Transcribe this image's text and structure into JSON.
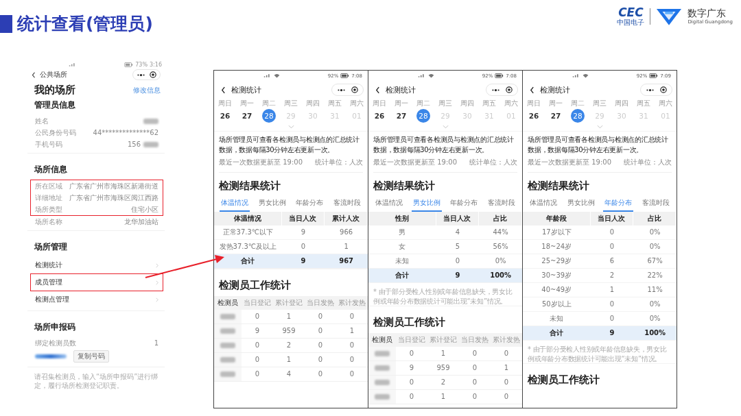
{
  "slide": {
    "title": "统计查看(管理员)"
  },
  "logos": {
    "cec": "CEC",
    "cec_cn": "中国电子",
    "brand_cn": "数字广东",
    "brand_en": "Digital Guangdong"
  },
  "venue_phone": {
    "battery": "73%",
    "time": "3:16",
    "nav_title": "公共场所",
    "page_title": "我的场所",
    "edit_link": "修改信息",
    "sections": [
      {
        "title": "管理员信息",
        "rows": [
          {
            "kind": "field",
            "label": "姓名",
            "redacted": true,
            "highlighted": false
          },
          {
            "kind": "field",
            "label": "公民身份号码",
            "value": "44**************62",
            "redacted": false,
            "highlighted": false
          },
          {
            "kind": "field",
            "label": "手机号码",
            "value": "156",
            "redacted": true,
            "highlighted": false
          }
        ]
      },
      {
        "title": "场所信息",
        "rows": [
          {
            "kind": "field",
            "label": "所在区域",
            "value": "广东省广州市海珠区新港街道",
            "redacted": false,
            "highlighted": true
          },
          {
            "kind": "field",
            "label": "详细地址",
            "value": "广东省广州市海珠区阅江西路",
            "redacted": false,
            "highlighted": true
          },
          {
            "kind": "field",
            "label": "场所类型",
            "value": "住宅小区",
            "redacted": false,
            "highlighted": true
          },
          {
            "kind": "field",
            "label": "场所名称",
            "value": "龙华加油站",
            "redacted": false,
            "highlighted": false
          }
        ]
      },
      {
        "title": "场所管理",
        "rows": [
          {
            "kind": "link",
            "label": "检测统计",
            "highlighted": false
          },
          {
            "kind": "link",
            "label": "成员管理",
            "highlighted": true
          },
          {
            "kind": "link",
            "label": "检测点管理",
            "highlighted": false
          }
        ]
      },
      {
        "title": "场所申报码",
        "rows": [
          {
            "kind": "field",
            "label": "绑定检测员数",
            "value": "1",
            "redacted": false,
            "highlighted": false
          },
          {
            "kind": "code",
            "button": "复制号码",
            "highlighted": false
          }
        ]
      }
    ],
    "hint": "请召集检测员，输入“场所申报码”进行绑定，履行场所检测登记职责。"
  },
  "link_arrow": true,
  "phones": [
    {
      "battery": "92%",
      "time": "7:08",
      "nav_title": "检测统计",
      "weekdays": [
        "周日",
        "周一",
        "周二",
        "周三",
        "周四",
        "周五",
        "周六"
      ],
      "dates": [
        {
          "label": "26",
          "selected": false,
          "future": false
        },
        {
          "label": "27",
          "selected": false,
          "future": false
        },
        {
          "label": "28",
          "selected": true,
          "future": false
        },
        {
          "label": "29",
          "selected": false,
          "future": true
        },
        {
          "label": "30",
          "selected": false,
          "future": true
        },
        {
          "label": "31",
          "selected": false,
          "future": true
        },
        {
          "label": "01",
          "selected": false,
          "future": true
        }
      ],
      "description": "场所管理员可查看各检测员与检测点的汇总统计数据，数据每隔30分钟左右更新一次。",
      "update_note": "最近一次数据更新至 19:00",
      "unit": "统计单位：人次",
      "result_heading": "检测结果统计",
      "tabs": [
        {
          "label": "体温情况",
          "selected": true
        },
        {
          "label": "男女比例",
          "selected": false
        },
        {
          "label": "年龄分布",
          "selected": false
        },
        {
          "label": "客流时段",
          "selected": false
        }
      ],
      "result_table": {
        "columns": [
          "体温情况",
          "当日人次",
          "累计人次"
        ],
        "rows": [
          {
            "cells": [
              "正常37.3℃以下",
              "9",
              "966"
            ],
            "total": false
          },
          {
            "cells": [
              "发热37.3℃及以上",
              "0",
              "1"
            ],
            "total": false
          },
          {
            "cells": [
              "合计",
              "9",
              "967"
            ],
            "total": true
          }
        ]
      },
      "work_heading": "检测员工作统计",
      "work_table": {
        "name_column": "检测员",
        "columns": [
          "当日登记",
          "累计登记",
          "当日发热",
          "累计发热"
        ],
        "rows": [
          {
            "cells": [
              "0",
              "1",
              "0",
              "0"
            ]
          },
          {
            "cells": [
              "9",
              "959",
              "0",
              "1"
            ]
          },
          {
            "cells": [
              "0",
              "2",
              "0",
              "0"
            ]
          },
          {
            "cells": [
              "0",
              "1",
              "0",
              "0"
            ]
          },
          {
            "cells": [
              "0",
              "4",
              "0",
              "0"
            ]
          }
        ]
      }
    },
    {
      "battery": "92%",
      "time": "7:08",
      "nav_title": "检测统计",
      "weekdays": [
        "周日",
        "周一",
        "周二",
        "周三",
        "周四",
        "周五",
        "周六"
      ],
      "dates": [
        {
          "label": "26",
          "selected": false,
          "future": false
        },
        {
          "label": "27",
          "selected": false,
          "future": false
        },
        {
          "label": "28",
          "selected": true,
          "future": false
        },
        {
          "label": "29",
          "selected": false,
          "future": true
        },
        {
          "label": "30",
          "selected": false,
          "future": true
        },
        {
          "label": "31",
          "selected": false,
          "future": true
        },
        {
          "label": "01",
          "selected": false,
          "future": true
        }
      ],
      "description": "场所管理员可查看各检测员与检测点的汇总统计数据，数据每隔30分钟左右更新一次。",
      "update_note": "最近一次数据更新至 19:00",
      "unit": "统计单位：人次",
      "result_heading": "检测结果统计",
      "tabs": [
        {
          "label": "体温情况",
          "selected": false
        },
        {
          "label": "男女比例",
          "selected": true
        },
        {
          "label": "年龄分布",
          "selected": false
        },
        {
          "label": "客流时段",
          "selected": false
        }
      ],
      "result_table": {
        "columns": [
          "性别",
          "当日人次",
          "占比"
        ],
        "rows": [
          {
            "cells": [
              "男",
              "4",
              "44%"
            ],
            "total": false
          },
          {
            "cells": [
              "女",
              "5",
              "56%"
            ],
            "total": false
          },
          {
            "cells": [
              "未知",
              "0",
              "0%"
            ],
            "total": false
          },
          {
            "cells": [
              "合计",
              "9",
              "100%"
            ],
            "total": true
          }
        ]
      },
      "note": "* 由于部分受检人性别或年龄信息缺失，男女比例或年龄分布数据统计可能出现“未知”情况。",
      "work_heading": "检测员工作统计",
      "work_table": {
        "name_column": "检测员",
        "columns": [
          "当日登记",
          "累计登记",
          "当日发热",
          "累计发热"
        ],
        "rows": [
          {
            "cells": [
              "0",
              "1",
              "0",
              "0"
            ]
          },
          {
            "cells": [
              "9",
              "959",
              "0",
              "1"
            ]
          },
          {
            "cells": [
              "0",
              "2",
              "0",
              "0"
            ]
          },
          {
            "cells": [
              "0",
              "1",
              "0",
              "0"
            ]
          }
        ]
      }
    },
    {
      "battery": "92%",
      "time": "7:09",
      "nav_title": "检测统计",
      "weekdays": [
        "周日",
        "周一",
        "周二",
        "周三",
        "周四",
        "周五",
        "周六"
      ],
      "dates": [
        {
          "label": "26",
          "selected": false,
          "future": false
        },
        {
          "label": "27",
          "selected": false,
          "future": false
        },
        {
          "label": "28",
          "selected": true,
          "future": false
        },
        {
          "label": "29",
          "selected": false,
          "future": true
        },
        {
          "label": "30",
          "selected": false,
          "future": true
        },
        {
          "label": "31",
          "selected": false,
          "future": true
        },
        {
          "label": "01",
          "selected": false,
          "future": true
        }
      ],
      "description": "场所管理员可查看各检测员与检测点的汇总统计数据，数据每隔30分钟左右更新一次。",
      "update_note": "最近一次数据更新至 19:00",
      "unit": "统计单位：人次",
      "result_heading": "检测结果统计",
      "tabs": [
        {
          "label": "体温情况",
          "selected": false
        },
        {
          "label": "男女比例",
          "selected": false
        },
        {
          "label": "年龄分布",
          "selected": true
        },
        {
          "label": "客流时段",
          "selected": false
        }
      ],
      "result_table": {
        "columns": [
          "年龄段",
          "当日人次",
          "占比"
        ],
        "rows": [
          {
            "cells": [
              "17岁以下",
              "0",
              "0%"
            ],
            "total": false
          },
          {
            "cells": [
              "18~24岁",
              "0",
              "0%"
            ],
            "total": false
          },
          {
            "cells": [
              "25~29岁",
              "6",
              "67%"
            ],
            "total": false
          },
          {
            "cells": [
              "30~39岁",
              "2",
              "22%"
            ],
            "total": false
          },
          {
            "cells": [
              "40~49岁",
              "1",
              "11%"
            ],
            "total": false
          },
          {
            "cells": [
              "50岁以上",
              "0",
              "0%"
            ],
            "total": false
          },
          {
            "cells": [
              "未知",
              "0",
              "0%"
            ],
            "total": false
          },
          {
            "cells": [
              "合计",
              "9",
              "100%"
            ],
            "total": true
          }
        ]
      },
      "note": "* 由于部分受检人性别或年龄信息缺失，男女比例或年龄分布数据统计可能出现“未知”情况。",
      "work_heading": "检测员工作统计"
    }
  ]
}
